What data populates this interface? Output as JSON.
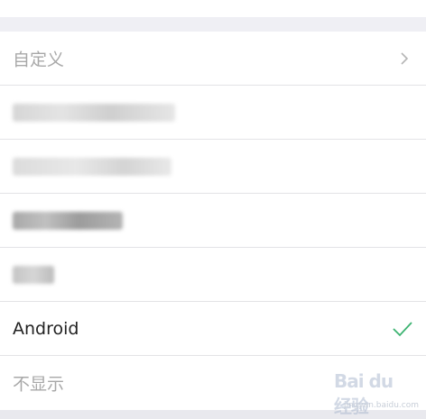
{
  "list": {
    "items": [
      {
        "label": "自定义",
        "muted": true,
        "trailing": "chevron"
      },
      {
        "label": "",
        "blurred": true
      },
      {
        "label": "",
        "blurred": true
      },
      {
        "label": "",
        "blurred": true
      },
      {
        "label": "",
        "blurred": true
      },
      {
        "label": "Android",
        "muted": false,
        "trailing": "check",
        "selected": true
      },
      {
        "label": "不显示",
        "muted": true
      }
    ]
  },
  "colors": {
    "accent_check": "#3cb371",
    "muted_text": "#a8a8a8",
    "background": "#efeff4"
  },
  "icons": {
    "chevron": "chevron-right-icon",
    "check": "check-icon"
  },
  "watermark": {
    "logo": "Bai du 经验",
    "text": "jingyan.baidu.com"
  }
}
